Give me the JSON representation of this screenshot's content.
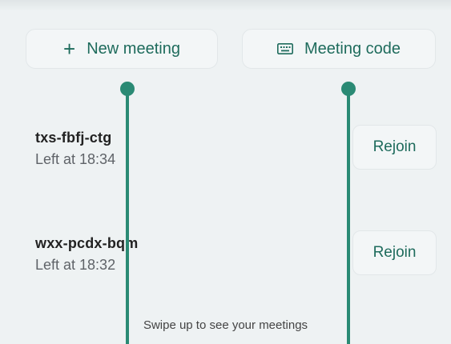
{
  "actions": {
    "new_meeting_label": "New meeting",
    "meeting_code_label": "Meeting code"
  },
  "meetings": [
    {
      "code": "txs-fbfj-ctg",
      "status": "Left at 18:34",
      "rejoin_label": "Rejoin"
    },
    {
      "code": "wxx-pcdx-bqm",
      "status": "Left at 18:32",
      "rejoin_label": "Rejoin"
    }
  ],
  "hint": "Swipe up to see your meetings",
  "colors": {
    "accent": "#1e6b5c",
    "overlay": "#2a8a74",
    "background": "#eef2f3"
  }
}
